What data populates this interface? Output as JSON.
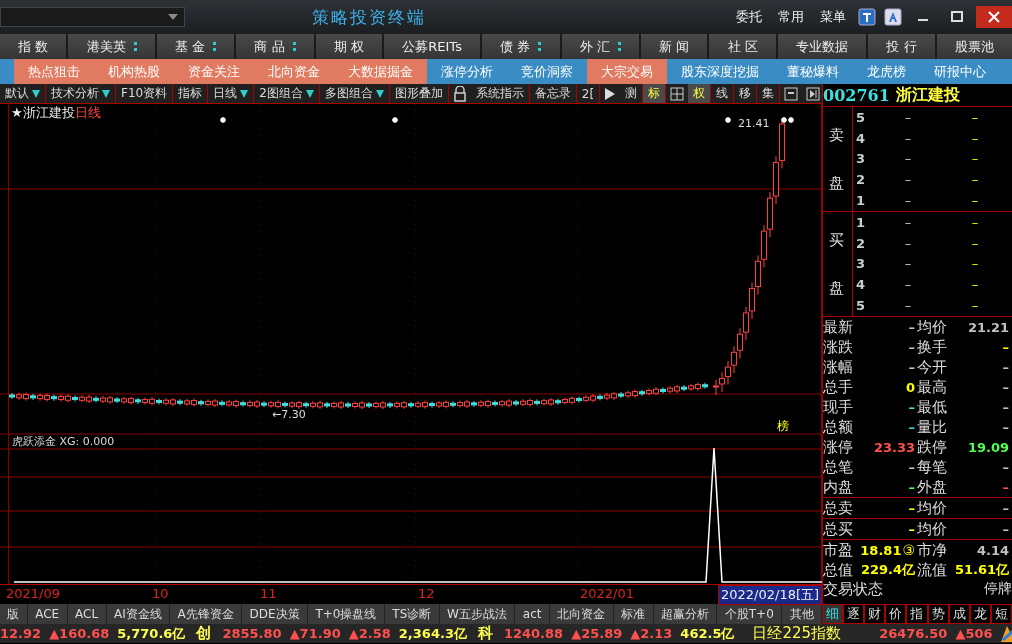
{
  "title_bar": {
    "title": "策略投资终端",
    "menus": [
      "委托",
      "常用",
      "菜单"
    ]
  },
  "nav_primary": [
    {
      "label": "指 数",
      "has_menu": false
    },
    {
      "label": "港美英",
      "has_menu": true
    },
    {
      "label": "基 金",
      "has_menu": true
    },
    {
      "label": "商 品",
      "has_menu": true
    },
    {
      "label": "期 权",
      "has_menu": false
    },
    {
      "label": "公募REITs",
      "has_menu": false
    },
    {
      "label": "债 券",
      "has_menu": true
    },
    {
      "label": "外 汇",
      "has_menu": true
    },
    {
      "label": "新 闻",
      "has_menu": false
    },
    {
      "label": "社 区",
      "has_menu": false
    },
    {
      "label": "专业数据",
      "has_menu": false
    },
    {
      "label": "投 行",
      "has_menu": false
    },
    {
      "label": "股票池",
      "has_menu": false
    }
  ],
  "nav_features": [
    {
      "label": "热点狙击",
      "color": "#e07a60"
    },
    {
      "label": "机构热股",
      "color": "#e07a60"
    },
    {
      "label": "资金关注",
      "color": "#e07a60"
    },
    {
      "label": "北向资金",
      "color": "#e07a60"
    },
    {
      "label": "大数据掘金",
      "color": "#e07a60"
    },
    {
      "label": "涨停分析",
      "color": "#3a8cc4"
    },
    {
      "label": "竞价洞察",
      "color": "#3a8cc4"
    },
    {
      "label": "大宗交易",
      "color": "#e07a60"
    },
    {
      "label": "股东深度挖掘",
      "color": "#3a8cc4"
    },
    {
      "label": "董秘爆料",
      "color": "#3a8cc4"
    },
    {
      "label": "龙虎榜",
      "color": "#3a8cc4"
    },
    {
      "label": "研报中心",
      "color": "#3a8cc4"
    }
  ],
  "toolbar": [
    {
      "kind": "dropdown",
      "label": "默认",
      "selected": false
    },
    {
      "kind": "dropdown",
      "label": "技术分析",
      "selected": false
    },
    {
      "kind": "button",
      "label": "F10资料",
      "selected": false
    },
    {
      "kind": "button",
      "label": "指标",
      "selected": false
    },
    {
      "kind": "dropdown",
      "label": "日线",
      "selected": false
    },
    {
      "kind": "dropdown",
      "label": "2图组合",
      "selected": false
    },
    {
      "kind": "dropdown",
      "label": "多图组合",
      "selected": false
    },
    {
      "kind": "button",
      "label": "图形叠加",
      "selected": false
    },
    {
      "kind": "lock"
    },
    {
      "kind": "button",
      "label": "系统指示",
      "selected": false
    },
    {
      "kind": "button",
      "label": "备忘录",
      "selected": false
    },
    {
      "kind": "button",
      "label": "2[",
      "selected": false
    },
    {
      "kind": "play"
    },
    {
      "kind": "button",
      "label": "测",
      "selected": false
    },
    {
      "kind": "button",
      "label": "标",
      "selected": true
    },
    {
      "kind": "grid"
    },
    {
      "kind": "button",
      "label": "权",
      "selected": true
    },
    {
      "kind": "button",
      "label": "线",
      "selected": false
    },
    {
      "kind": "button",
      "label": "移",
      "selected": false
    },
    {
      "kind": "button",
      "label": "集",
      "selected": false
    },
    {
      "kind": "panel"
    },
    {
      "kind": "next"
    }
  ],
  "chart": {
    "title": "★浙江建投",
    "period": "日线",
    "high_label": "21.41",
    "low_label": "←7.30",
    "badge": "榜",
    "indicator": "虎跃添金 XG: 0.000",
    "dates": [
      {
        "label": "2021/09",
        "selected": false
      },
      {
        "label": "10",
        "selected": false
      },
      {
        "label": "11",
        "selected": false
      },
      {
        "label": "12",
        "selected": false
      },
      {
        "label": "2022/01",
        "selected": false
      },
      {
        "label": "2022/02/18[五]",
        "selected": true
      }
    ]
  },
  "quote": {
    "code": "002761",
    "name": "浙江建投",
    "sell_label": "卖盘",
    "buy_label": "买盘",
    "sell": [
      {
        "level": "5",
        "price": "–",
        "volume": "–"
      },
      {
        "level": "4",
        "price": "–",
        "volume": "–"
      },
      {
        "level": "3",
        "price": "–",
        "volume": "–"
      },
      {
        "level": "2",
        "price": "–",
        "volume": "–"
      },
      {
        "level": "1",
        "price": "–",
        "volume": "–"
      }
    ],
    "buy": [
      {
        "level": "1",
        "price": "–",
        "volume": "–"
      },
      {
        "level": "2",
        "price": "–",
        "volume": "–"
      },
      {
        "level": "3",
        "price": "–",
        "volume": "–"
      },
      {
        "level": "4",
        "price": "–",
        "volume": "–"
      },
      {
        "level": "5",
        "price": "–",
        "volume": "–"
      }
    ],
    "stat_groups": [
      [
        [
          {
            "label": "最新",
            "value": "–",
            "color": "#c0c0c0"
          },
          {
            "label": "均价",
            "value": "21.21",
            "color": "#c0c0c0"
          }
        ],
        [
          {
            "label": "涨跌",
            "value": "–",
            "color": "#c0c0c0"
          },
          {
            "label": "换手",
            "value": "–",
            "color": "#ffff00"
          }
        ],
        [
          {
            "label": "涨幅",
            "value": "–",
            "color": "#c0c0c0"
          },
          {
            "label": "今开",
            "value": "–",
            "color": "#c0c0c0"
          }
        ],
        [
          {
            "label": "总手",
            "value": "0",
            "color": "#ffff00"
          },
          {
            "label": "最高",
            "value": "–",
            "color": "#c0c0c0"
          }
        ],
        [
          {
            "label": "现手",
            "value": "–",
            "color": "#40e0e0"
          },
          {
            "label": "最低",
            "value": "–",
            "color": "#c0c0c0"
          }
        ],
        [
          {
            "label": "总额",
            "value": "–",
            "color": "#40e0e0"
          },
          {
            "label": "量比",
            "value": "–",
            "color": "#c0c0c0"
          }
        ],
        [
          {
            "label": "涨停",
            "value": "23.33",
            "color": "#ff5050"
          },
          {
            "label": "跌停",
            "value": "19.09",
            "color": "#50ff50"
          }
        ],
        [
          {
            "label": "总笔",
            "value": "–",
            "color": "#c0c0c0"
          },
          {
            "label": "每笔",
            "value": "–",
            "color": "#c0c0c0"
          }
        ],
        [
          {
            "label": "内盘",
            "value": "–",
            "color": "#50ff50"
          },
          {
            "label": "外盘",
            "value": "–",
            "color": "#ff5050"
          }
        ]
      ],
      [
        [
          {
            "label": "总卖",
            "value": "–",
            "color": "#ffff00"
          },
          {
            "label": "均价",
            "value": "–",
            "color": "#c0c0c0"
          }
        ]
      ],
      [
        [
          {
            "label": "总买",
            "value": "–",
            "color": "#ffff00"
          },
          {
            "label": "均价",
            "value": "–",
            "color": "#c0c0c0"
          }
        ]
      ]
    ],
    "valuation": [
      [
        {
          "label": "市盈",
          "value": "18.81",
          "badge": "③",
          "color": "#ffff00"
        },
        {
          "label": "市净",
          "value": "4.14",
          "color": "#c0c0c0"
        }
      ],
      [
        {
          "label": "总值",
          "value": "229.4亿",
          "color": "#ffff00"
        },
        {
          "label": "流值",
          "value": "51.61亿",
          "color": "#ffff00"
        }
      ]
    ],
    "status_label": "交易状态",
    "status_value": "停牌",
    "detail_tabs": [
      {
        "label": "细",
        "selected": true
      },
      {
        "label": "逐",
        "selected": false
      },
      {
        "label": "财",
        "selected": false
      },
      {
        "label": "价",
        "selected": false
      },
      {
        "label": "指",
        "selected": false
      },
      {
        "label": "势",
        "selected": false
      },
      {
        "label": "成",
        "selected": false
      },
      {
        "label": "龙",
        "selected": false
      },
      {
        "label": "短",
        "selected": false
      }
    ]
  },
  "indicator_tabs": [
    "版",
    "ACE",
    "ACL",
    "AI资金线",
    "A先锋资金",
    "DDE决策",
    "T+0操盘线",
    "TS诊断",
    "W五步战法",
    "act",
    "北向资金",
    "标准",
    "超赢分析",
    "个股T+0",
    "其他"
  ],
  "ticker": [
    {
      "kind": "value",
      "text": "12.92",
      "color": "#ff5050"
    },
    {
      "kind": "value",
      "text": "▲160.68",
      "color": "#ff5050"
    },
    {
      "kind": "value",
      "text": "5,770.6亿",
      "color": "#ffff50"
    },
    {
      "kind": "market",
      "text": "创",
      "color": "#ffff50"
    },
    {
      "kind": "value",
      "text": "2855.80",
      "color": "#ff5050"
    },
    {
      "kind": "value",
      "text": "▲71.90",
      "color": "#ff5050"
    },
    {
      "kind": "value",
      "text": "▲2.58",
      "color": "#ff5050"
    },
    {
      "kind": "value",
      "text": "2,364.3亿",
      "color": "#ffff50"
    },
    {
      "kind": "market",
      "text": "科",
      "color": "#ffff50"
    },
    {
      "kind": "value",
      "text": "1240.88",
      "color": "#ff5050"
    },
    {
      "kind": "value",
      "text": "▲25.89",
      "color": "#ff5050"
    },
    {
      "kind": "value",
      "text": "▲2.13",
      "color": "#ff5050"
    },
    {
      "kind": "value",
      "text": "462.5亿",
      "color": "#ffff50"
    },
    {
      "kind": "index",
      "text": "日经225指数",
      "color": "#ffff50"
    },
    {
      "kind": "value",
      "text": "26476.50",
      "color": "#ff5050"
    },
    {
      "kind": "value",
      "text": "▲506",
      "color": "#ff5050"
    }
  ]
}
